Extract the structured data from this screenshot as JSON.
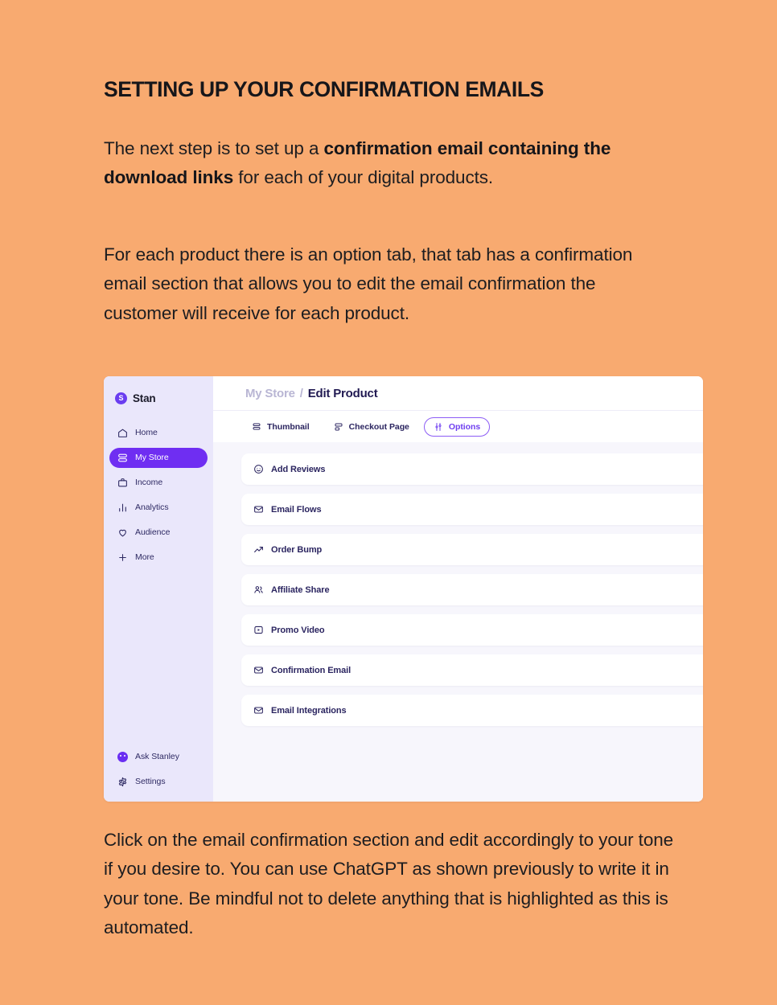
{
  "theme": {
    "page_bg": "#f8aa70",
    "accent_purple": "#6f2ef2",
    "text_dark": "#16161a",
    "sidebar_bg": "#eae7fb",
    "panel_bg": "#f7f6fc",
    "label_navy": "#2b2560"
  },
  "article": {
    "heading": "SETTING UP YOUR CONFIRMATION EMAILS",
    "para1_part1": "The next step is to set up a ",
    "para1_bold": "confirmation email containing the download links",
    "para1_part2": " for each of your digital products.",
    "para2": "For each product there is an option tab, that tab has a confirmation email section that allows you to edit the email confirmation the customer will receive for each product.",
    "para3": "Click on the email confirmation section and edit accordingly to your tone if you desire to. You can use ChatGPT as shown previously to write it in your tone. Be mindful not to delete anything that is highlighted as this is automated."
  },
  "app": {
    "brand": {
      "mark_letter": "S",
      "name": "Stan"
    },
    "sidebar": {
      "items": [
        {
          "label": "Home",
          "icon": "home-icon",
          "active": false
        },
        {
          "label": "My Store",
          "icon": "store-icon",
          "active": true
        },
        {
          "label": "Income",
          "icon": "briefcase-icon",
          "active": false
        },
        {
          "label": "Analytics",
          "icon": "bar-chart-icon",
          "active": false
        },
        {
          "label": "Audience",
          "icon": "heart-icon",
          "active": false
        },
        {
          "label": "More",
          "icon": "plus-icon",
          "active": false
        }
      ],
      "bottom_items": [
        {
          "label": "Ask Stanley",
          "icon": "stanley-avatar-icon"
        },
        {
          "label": "Settings",
          "icon": "gear-icon"
        }
      ]
    },
    "breadcrumb": {
      "parent": "My Store",
      "separator": "/",
      "current": "Edit Product"
    },
    "tabs": [
      {
        "label": "Thumbnail",
        "icon": "layers-icon",
        "active": false
      },
      {
        "label": "Checkout Page",
        "icon": "layout-icon",
        "active": false
      },
      {
        "label": "Options",
        "icon": "sliders-icon",
        "active": true
      }
    ],
    "sections": [
      {
        "label": "Add Reviews",
        "icon": "smiley-icon",
        "chevron": "chevron-down-icon",
        "expanded": false
      },
      {
        "label": "Email Flows",
        "icon": "envelope-icon",
        "chevron": "chevron-down-icon",
        "expanded": false
      },
      {
        "label": "Order Bump",
        "icon": "trend-up-icon",
        "chevron": "chevron-down-icon",
        "expanded": false
      },
      {
        "label": "Affiliate Share",
        "icon": "users-icon",
        "chevron": "chevron-down-icon",
        "expanded": false
      },
      {
        "label": "Promo Video",
        "icon": "play-box-icon",
        "chevron": "chevron-down-icon",
        "expanded": false
      },
      {
        "label": "Confirmation Email",
        "icon": "envelope-icon",
        "chevron": "chevron-down-icon",
        "expanded": false
      },
      {
        "label": "Email Integrations",
        "icon": "envelope-icon",
        "chevron": "chevron-down-icon",
        "expanded": false
      }
    ]
  }
}
